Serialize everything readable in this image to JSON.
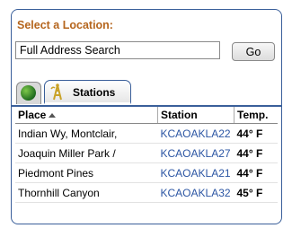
{
  "header": {
    "title": "Select a Location:"
  },
  "search": {
    "value": "Full Address Search",
    "button_label": "Go"
  },
  "tabs": [
    {
      "icon": "globe-icon"
    },
    {
      "icon": "weather-station-icon",
      "label": "Stations"
    }
  ],
  "table": {
    "columns": [
      "Place",
      "Station",
      "Temp."
    ],
    "rows": [
      {
        "place": "Indian Wy, Montclair,",
        "station": "KCAOAKLA22",
        "temp": "44° F"
      },
      {
        "place": "Joaquin Miller Park /",
        "station": "KCAOAKLA27",
        "temp": "44° F"
      },
      {
        "place": "Piedmont Pines",
        "station": "KCAOAKLA21",
        "temp": "44° F"
      },
      {
        "place": "Thornhill Canyon",
        "station": "KCAOAKLA32",
        "temp": "45° F"
      }
    ]
  },
  "colors": {
    "title": "#b5651d",
    "border": "#3a5f9a",
    "link": "#2b55a3"
  }
}
